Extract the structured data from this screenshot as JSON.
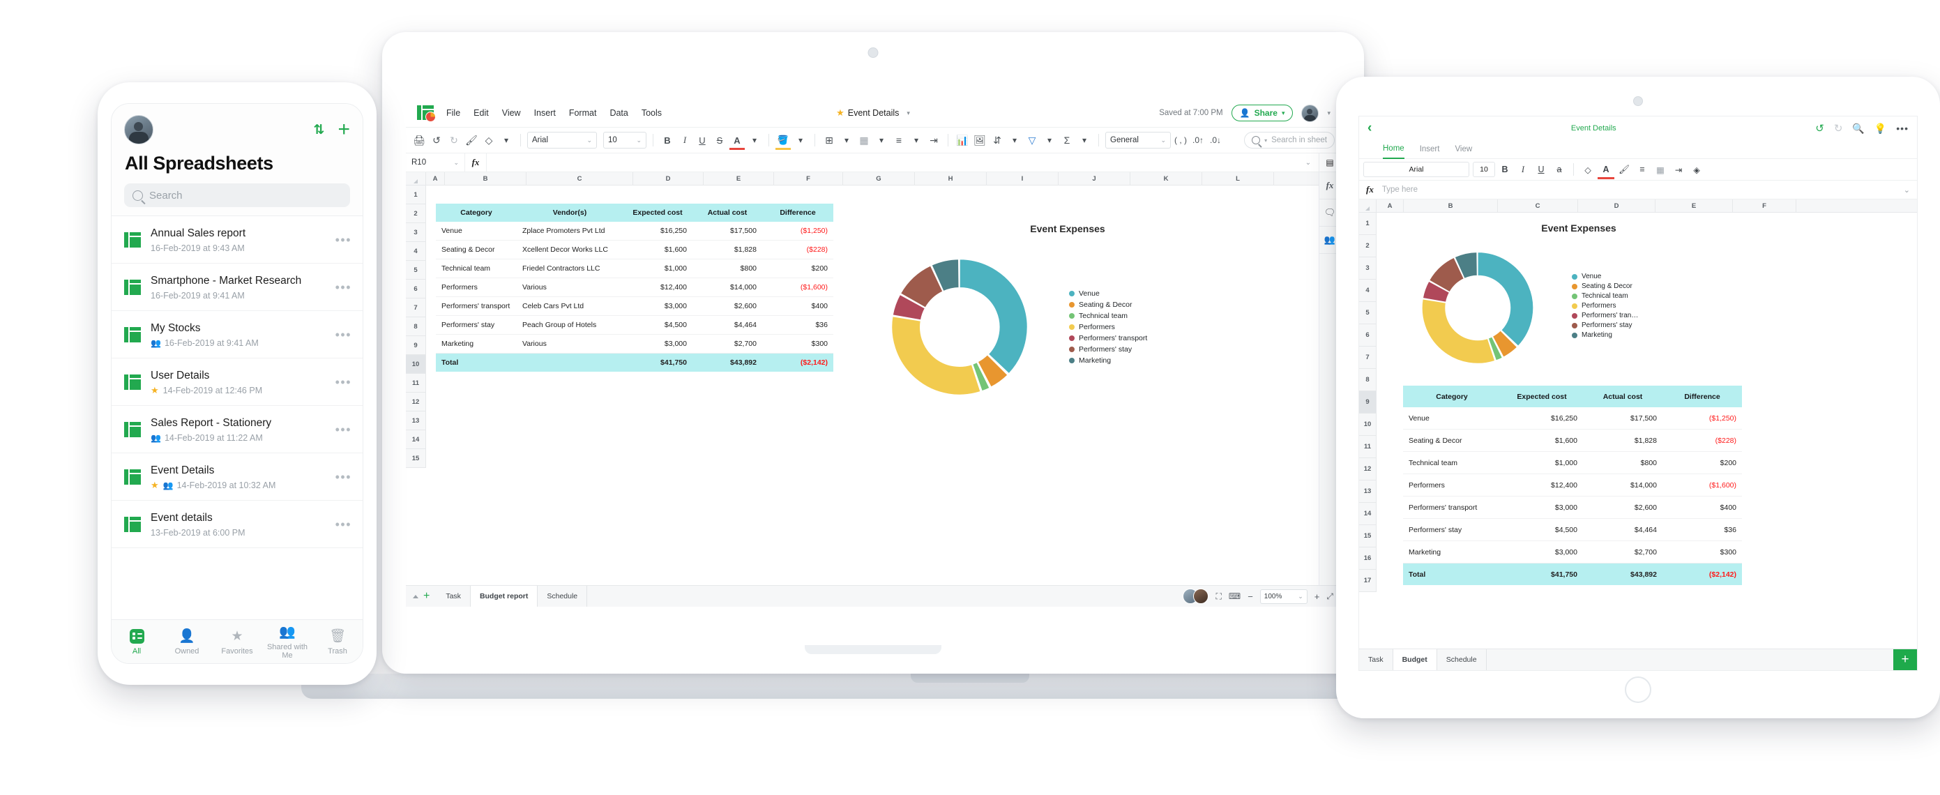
{
  "phone": {
    "title": "All Spreadsheets",
    "sort_icon": "sort-icon",
    "add_icon": "plus-icon",
    "search": {
      "placeholder": "Search",
      "icon": "search-icon"
    },
    "files": [
      {
        "name": "Annual Sales report",
        "meta": "16-Feb-2019 at 9:43 AM",
        "star": false,
        "shared": false
      },
      {
        "name": "Smartphone - Market Research",
        "meta": "16-Feb-2019 at 9:41 AM",
        "star": false,
        "shared": false
      },
      {
        "name": "My Stocks",
        "meta": "16-Feb-2019 at 9:41 AM",
        "star": false,
        "shared": true
      },
      {
        "name": "User Details",
        "meta": "14-Feb-2019 at 12:46 PM",
        "star": true,
        "shared": false
      },
      {
        "name": "Sales Report - Stationery",
        "meta": "14-Feb-2019 at 11:22 AM",
        "star": false,
        "shared": true
      },
      {
        "name": "Event Details",
        "meta": "14-Feb-2019 at 10:32 AM",
        "star": true,
        "shared": true
      },
      {
        "name": "Event details",
        "meta": "13-Feb-2019 at 6:00 PM",
        "star": false,
        "shared": false
      }
    ],
    "tabs": [
      {
        "label": "All",
        "icon": "list-icon",
        "active": true
      },
      {
        "label": "Owned",
        "icon": "person-icon",
        "active": false
      },
      {
        "label": "Favorites",
        "icon": "star-icon",
        "active": false
      },
      {
        "label": "Shared with Me",
        "icon": "people-icon",
        "active": false
      },
      {
        "label": "Trash",
        "icon": "trash-icon",
        "active": false
      }
    ]
  },
  "laptop": {
    "menus": [
      "File",
      "Edit",
      "View",
      "Insert",
      "Format",
      "Data",
      "Tools"
    ],
    "doc_title": "Event Details",
    "saved_text": "Saved at 7:00 PM",
    "share_label": "Share",
    "font_name": "Arial",
    "font_size": "10",
    "number_format": "General",
    "search_placeholder": "Search in sheet",
    "name_box": "R10",
    "fx_label": "fx",
    "columns": [
      "A",
      "B",
      "C",
      "D",
      "E",
      "F",
      "G",
      "H",
      "I",
      "J",
      "K",
      "L"
    ],
    "rows": [
      "1",
      "2",
      "3",
      "4",
      "5",
      "6",
      "7",
      "8",
      "9",
      "10",
      "11",
      "12",
      "13",
      "14",
      "15"
    ],
    "active_row": "10",
    "sheet_tabs": [
      {
        "label": "Task",
        "active": false
      },
      {
        "label": "Budget report",
        "active": true
      },
      {
        "label": "Schedule",
        "active": false
      }
    ],
    "zoom": "100%",
    "toolbar_icons": [
      "print-icon",
      "undo-icon",
      "redo-icon",
      "paint-format-icon",
      "eraser-icon",
      "fill-color-icon",
      "borders-icon",
      "merge-cells-icon",
      "align-icon",
      "wrap-text-icon",
      "chart-icon",
      "image-icon",
      "sort-icon",
      "filter-icon",
      "sum-icon",
      "increase-decimal-icon",
      "decrease-decimal-icon"
    ],
    "rail_icons": [
      "sheet-view-icon",
      "fx-icon",
      "comment-icon",
      "collaborator-icon"
    ]
  },
  "tablet": {
    "back_icon": "chevron-left-icon",
    "doc_title": "Event Details",
    "header_icons": [
      "undo-icon",
      "redo-icon",
      "search-icon",
      "bulb-icon",
      "more-icon"
    ],
    "ribbon_tabs": [
      {
        "label": "Home",
        "active": true
      },
      {
        "label": "Insert",
        "active": false
      },
      {
        "label": "View",
        "active": false
      }
    ],
    "font_name": "Arial",
    "font_size": "10",
    "format_icons": [
      "bold-icon",
      "italic-icon",
      "underline-icon",
      "strikethrough-icon",
      "fill-color-icon",
      "text-color-icon",
      "paint-format-icon",
      "align-icon",
      "borders-icon",
      "wrap-text-icon",
      "clear-format-icon"
    ],
    "fx_label": "fx",
    "formula_placeholder": "Type here",
    "columns": [
      "A",
      "B",
      "C",
      "D",
      "E",
      "F"
    ],
    "rows": [
      "1",
      "2",
      "3",
      "4",
      "5",
      "6",
      "7",
      "8",
      "9",
      "10",
      "11",
      "12",
      "13",
      "14",
      "15",
      "16",
      "17"
    ],
    "active_row": "9",
    "sheet_tabs": [
      {
        "label": "Task",
        "active": false
      },
      {
        "label": "Budget",
        "active": true
      },
      {
        "label": "Schedule",
        "active": false
      }
    ],
    "add_sheet_icon": "plus-icon"
  },
  "budget_table": {
    "headers_full": [
      "Category",
      "Vendor(s)",
      "Expected cost",
      "Actual cost",
      "Difference"
    ],
    "headers_compact": [
      "Category",
      "Expected cost",
      "Actual cost",
      "Difference"
    ],
    "rows": [
      {
        "category": "Venue",
        "vendor": "Zplace Promoters Pvt Ltd",
        "expected": "$16,250",
        "actual": "$17,500",
        "difference": "($1,250)",
        "negative": true
      },
      {
        "category": "Seating & Decor",
        "vendor": "Xcellent Decor Works LLC",
        "expected": "$1,600",
        "actual": "$1,828",
        "difference": "($228)",
        "negative": true
      },
      {
        "category": "Technical team",
        "vendor": "Friedel Contractors LLC",
        "expected": "$1,000",
        "actual": "$800",
        "difference": "$200",
        "negative": false
      },
      {
        "category": "Performers",
        "vendor": "Various",
        "expected": "$12,400",
        "actual": "$14,000",
        "difference": "($1,600)",
        "negative": true
      },
      {
        "category": "Performers' transport",
        "vendor": "Celeb Cars Pvt Ltd",
        "expected": "$3,000",
        "actual": "$2,600",
        "difference": "$400",
        "negative": false
      },
      {
        "category": "Performers' stay",
        "vendor": "Peach Group of Hotels",
        "expected": "$4,500",
        "actual": "$4,464",
        "difference": "$36",
        "negative": false
      },
      {
        "category": "Marketing",
        "vendor": "Various",
        "expected": "$3,000",
        "actual": "$2,700",
        "difference": "$300",
        "negative": false
      }
    ],
    "total": {
      "category": "Total",
      "vendor": "",
      "expected": "$41,750",
      "actual": "$43,892",
      "difference": "($2,142)",
      "negative": true
    }
  },
  "chart_data": {
    "type": "pie",
    "title": "Event Expenses",
    "subtitle": "",
    "xlabel": "",
    "ylabel": "",
    "legend_position": "right",
    "donut": true,
    "categories": [
      "Venue",
      "Seating & Decor",
      "Technical team",
      "Performers",
      "Performers' transport",
      "Performers' stay",
      "Marketing"
    ],
    "values": [
      17500,
      1828,
      800,
      14000,
      2600,
      4464,
      2700
    ],
    "percentages": [
      39.9,
      4.2,
      1.8,
      31.9,
      5.9,
      10.2,
      6.2
    ],
    "colors": [
      "#4cb3c0",
      "#e8962f",
      "#74c476",
      "#f2cb4f",
      "#b0485a",
      "#9e5b4c",
      "#4c7f86"
    ],
    "legend_truncated": [
      "Venue",
      "Seating & Decor",
      "Technical team",
      "Performers",
      "Performers' tran…",
      "Performers' stay",
      "Marketing"
    ]
  }
}
